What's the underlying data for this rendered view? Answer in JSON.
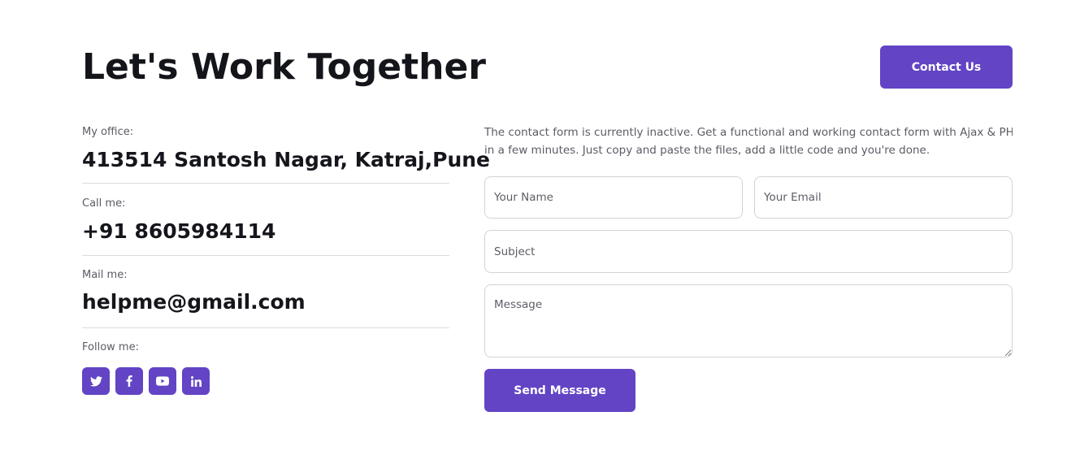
{
  "header": {
    "title": "Let's Work Together",
    "contact_button": "Contact Us"
  },
  "info": {
    "office_label": "My office:",
    "office_value": "413514 Santosh Nagar, Katraj,Pune",
    "call_label": "Call me:",
    "call_value": "+91 8605984114",
    "mail_label": "Mail me:",
    "mail_value": "helpme@gmail.com",
    "follow_label": "Follow me:",
    "socials": [
      "twitter-icon",
      "facebook-icon",
      "youtube-icon",
      "linkedin-icon"
    ]
  },
  "form": {
    "description": [
      "The contact form is currently inactive. Get a functional and working contact form with Ajax & PHP",
      "in a few minutes. Just copy and paste the files, add a little code and you're done."
    ],
    "name_placeholder": "Your Name",
    "email_placeholder": "Your Email",
    "subject_placeholder": "Subject",
    "message_placeholder": "Message",
    "send_button": "Send Message"
  },
  "colors": {
    "accent": "#6244c5",
    "text": "#15161c",
    "muted": "#5b5b66",
    "border": "#d3d3d8"
  }
}
